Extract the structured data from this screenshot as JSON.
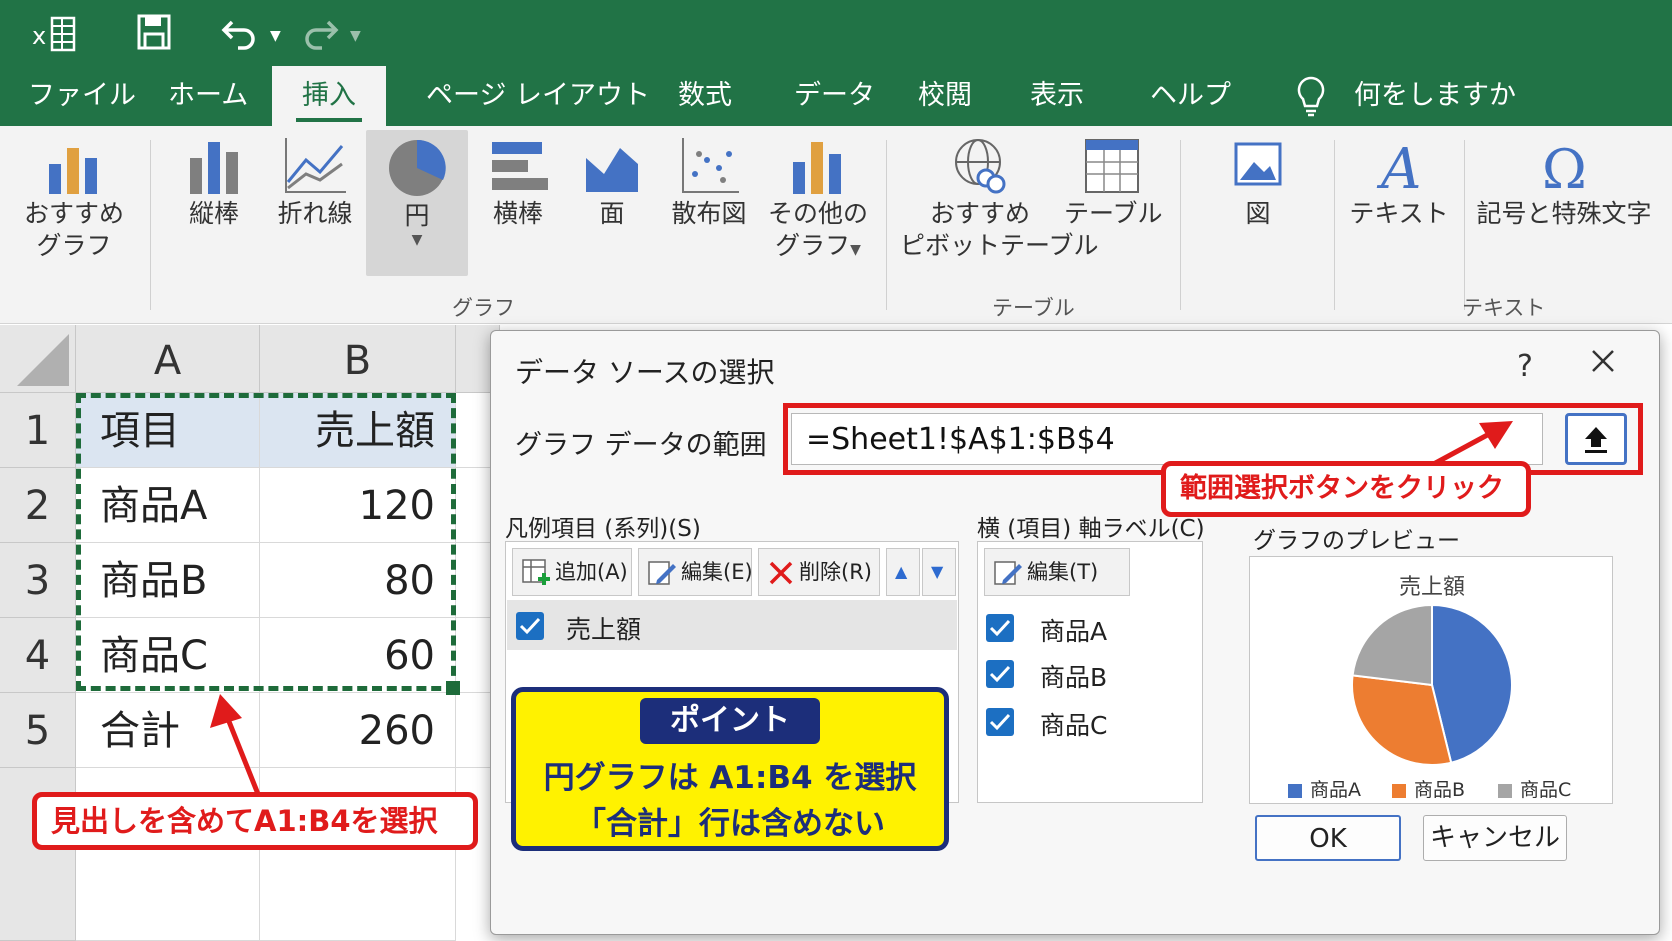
{
  "title_bar": {
    "icons": [
      "excel-icon",
      "save-icon",
      "undo-icon",
      "redo-icon"
    ],
    "bg_color": "#217346"
  },
  "tabs": [
    "ファイル",
    "ホーム",
    "挿入",
    "ページ レイアウト",
    "数式",
    "データ",
    "校閲",
    "表示",
    "ヘルプ"
  ],
  "active_tab": "挿入",
  "tell_me": "何をしますか",
  "ribbon": {
    "recommended_chart": {
      "line1": "おすすめ",
      "line2": "グラフ"
    },
    "column": "縦棒",
    "line": "折れ線",
    "pie": "円",
    "bar": "横棒",
    "area": "面",
    "scatter": "散布図",
    "other": {
      "line1": "その他の",
      "line2": "グラフ"
    },
    "recommended_pivot": {
      "line1": "おすすめ",
      "line2": "ピボットテーブル"
    },
    "table": "テーブル",
    "picture": "図",
    "textbox": "テキスト",
    "symbol": "記号と特殊文字",
    "groups": {
      "chart": "グラフ",
      "table": "テーブル",
      "text": "テキスト"
    }
  },
  "sheet": {
    "columns": [
      "A",
      "B"
    ],
    "rows": [
      {
        "num": "1",
        "a": "項目",
        "b": "売上額"
      },
      {
        "num": "2",
        "a": "商品A",
        "b": "120"
      },
      {
        "num": "3",
        "a": "商品B",
        "b": "80"
      },
      {
        "num": "4",
        "a": "商品C",
        "b": "60"
      },
      {
        "num": "5",
        "a": "合計",
        "b": "260"
      }
    ]
  },
  "callouts": {
    "sheet": "見出しを含めてA1:B4を選択",
    "range_button": "範囲選択ボタンをクリック"
  },
  "dialog": {
    "title": "データ ソースの選択",
    "help": "?",
    "range_label": "グラフ データの範囲",
    "range_value": "=Sheet1!$A$1:$B$4",
    "series_label": "凡例項目 (系列)(S)",
    "series_buttons": {
      "add": "追加(A)",
      "edit": "編集(E)",
      "delete": "削除(R)"
    },
    "series_items": [
      "売上額"
    ],
    "axis_label": "横 (項目) 軸ラベル(C)",
    "axis_edit": "編集(T)",
    "axis_items": [
      "商品A",
      "商品B",
      "商品C"
    ],
    "preview_label": "グラフのプレビュー",
    "ok": "OK",
    "cancel": "キャンセル"
  },
  "preview_chart": {
    "title": "売上額"
  },
  "chart_data": {
    "type": "pie",
    "title": "売上額",
    "categories": [
      "商品A",
      "商品B",
      "商品C"
    ],
    "values": [
      120,
      80,
      60
    ],
    "colors": [
      "#4472c4",
      "#ed7d31",
      "#a5a5a5"
    ],
    "legend": "bottom"
  },
  "point_box": {
    "tag": "ポイント",
    "line1": "円グラフは A1:B4 を選択",
    "line2": "「合計」行は含めない"
  },
  "colors": {
    "excel_green": "#217346",
    "header_fill": "#dbe5f1",
    "callout_red": "#e01b1b",
    "point_yellow": "#fff200",
    "point_navy": "#1c2e7a",
    "check_blue": "#1c6fc2"
  }
}
